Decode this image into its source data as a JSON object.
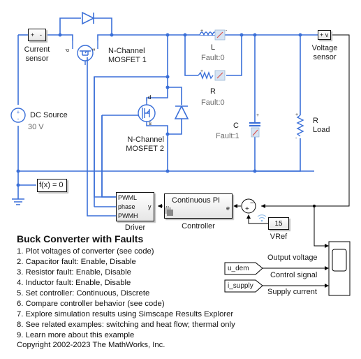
{
  "model": {
    "title": "Buck Converter with Faults",
    "steps": [
      "1. Plot voltages of converter (see code)",
      "2. Capacitor fault: Enable, Disable",
      "3. Resistor fault: Enable, Disable",
      "4. Inductor fault: Enable, Disable",
      "5. Set controller: Continuous, Discrete",
      "6. Compare controller behavior (see code)",
      "7. Explore simulation results using Simscape Results Explorer",
      "8. See related examples: switching and heat flow; thermal only",
      "9. Learn more about this example"
    ],
    "copyright": "Copyright 2002-2023 The MathWorks, Inc."
  },
  "blocks": {
    "current_sensor": {
      "label_line1": "Current",
      "label_line2": "sensor",
      "port_plus": "+",
      "port_minus": "-"
    },
    "mosfet1": {
      "label_line1": "N-Channel",
      "label_line2": "MOSFET 1",
      "port_d": "d",
      "port_s": "s"
    },
    "mosfet2": {
      "label_line1": "N-Channel",
      "label_line2": "MOSFET 2",
      "port_d": "d",
      "port_s": "s"
    },
    "dc_source": {
      "label": "DC Source",
      "value": "30 V"
    },
    "inductor": {
      "label": "L",
      "fault": "Fault:0"
    },
    "resistor": {
      "label": "R",
      "fault": "Fault:0"
    },
    "capacitor": {
      "label": "C",
      "fault": "Fault:1"
    },
    "load": {
      "label_line1": "R",
      "label_line2": "Load"
    },
    "voltage_sensor": {
      "label_line1": "Voltage",
      "label_line2": "sensor",
      "port_text": "+ v"
    },
    "solver": {
      "text": "f(x) = 0"
    },
    "driver": {
      "label": "Driver",
      "port_pwml": "PWML",
      "port_phase": "phase",
      "port_pwmh": "PWMH",
      "port_y": "y"
    },
    "controller": {
      "label": "Controller",
      "title": "Continuous PI",
      "port_u": "u",
      "port_e": "e"
    },
    "sum": {
      "minus": "−",
      "plus": "+"
    },
    "vref": {
      "label": "VRef",
      "value": "15"
    },
    "goto_u_dem": {
      "text": "u_dem"
    },
    "goto_i_supply": {
      "text": "i_supply"
    },
    "scope": {
      "signals": [
        "Output voltage",
        "Control signal",
        "Supply current"
      ]
    }
  },
  "colors": {
    "physical_wire": "#3a6fd8",
    "signal_wire": "#000000",
    "fault_icon": "#d9534f"
  }
}
